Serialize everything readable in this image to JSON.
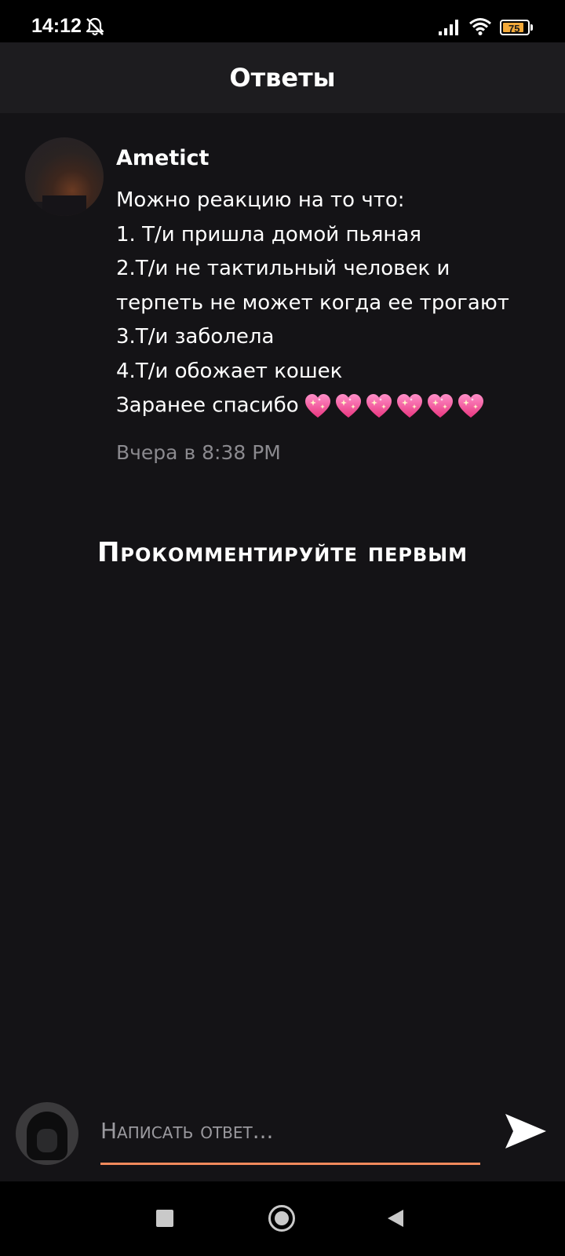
{
  "status_bar": {
    "time": "14:12",
    "battery_level": "75",
    "battery_color": "#f2a93a",
    "icons": [
      "bell-muted-icon",
      "signal-icon",
      "wifi-icon",
      "battery-icon"
    ]
  },
  "header": {
    "title": "Ответы"
  },
  "comment": {
    "author": "Ametict",
    "lines": [
      "Можно реакцию на то что:",
      "1. Т/и пришла домой пьяная",
      "2.Т/и не тактильный человек и",
      "терпеть не может когда ее трогают",
      "3.Т/и заболела",
      "4.Т/и обожает кошек",
      "Заранее спасибо"
    ],
    "emoji": "sparkling-heart-icon",
    "emoji_count": 6,
    "timestamp": "Вчера в 8:38 PM"
  },
  "empty_state": {
    "text": "Прокомментируйте первым"
  },
  "reply": {
    "placeholder": "Написать ответ...",
    "accent_color": "#f28a5c",
    "send_icon": "send-icon"
  },
  "nav": {
    "icons": [
      "recents-icon",
      "home-icon",
      "back-icon"
    ]
  }
}
